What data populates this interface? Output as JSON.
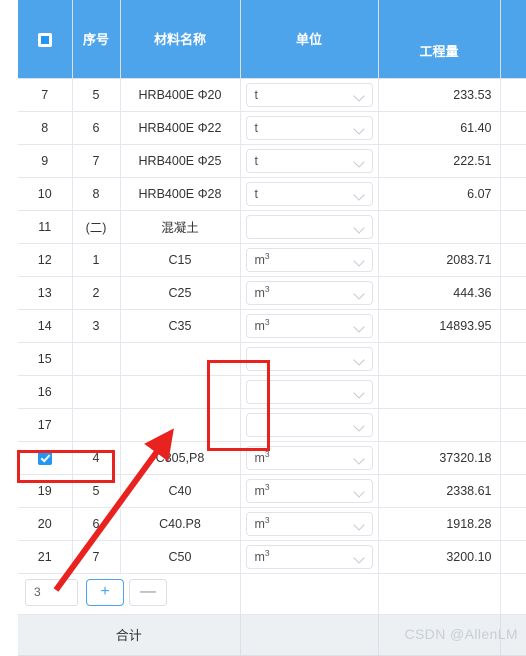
{
  "table": {
    "columns": [
      {
        "key": "check",
        "label": "",
        "icon": "indeterminate-checkbox-icon"
      },
      {
        "key": "seq",
        "label": "序号"
      },
      {
        "key": "name",
        "label": "材料名称"
      },
      {
        "key": "unit",
        "label": "单位"
      },
      {
        "key": "qty",
        "label": "工程量"
      },
      {
        "key": "tail",
        "label": ""
      }
    ],
    "rows": [
      {
        "idx": "7",
        "seq": "5",
        "name": "HRB400E Φ20",
        "unit": "t",
        "unit_sup": "",
        "qty": "233.53",
        "checked": false
      },
      {
        "idx": "8",
        "seq": "6",
        "name": "HRB400E Φ22",
        "unit": "t",
        "unit_sup": "",
        "qty": "61.40",
        "checked": false
      },
      {
        "idx": "9",
        "seq": "7",
        "name": "HRB400E Φ25",
        "unit": "t",
        "unit_sup": "",
        "qty": "222.51",
        "checked": false
      },
      {
        "idx": "10",
        "seq": "8",
        "name": "HRB400E Φ28",
        "unit": "t",
        "unit_sup": "",
        "qty": "6.07",
        "checked": false
      },
      {
        "idx": "11",
        "seq": "(二)",
        "name": "混凝土",
        "unit": "",
        "unit_sup": "",
        "qty": "",
        "checked": false
      },
      {
        "idx": "12",
        "seq": "1",
        "name": "C15",
        "unit": "m",
        "unit_sup": "3",
        "qty": "2083.71",
        "checked": false
      },
      {
        "idx": "13",
        "seq": "2",
        "name": "C25",
        "unit": "m",
        "unit_sup": "3",
        "qty": "444.36",
        "checked": false
      },
      {
        "idx": "14",
        "seq": "3",
        "name": "C35",
        "unit": "m",
        "unit_sup": "3",
        "qty": "14893.95",
        "checked": false
      },
      {
        "idx": "15",
        "seq": "",
        "name": "",
        "unit": "",
        "unit_sup": "",
        "qty": "",
        "checked": false
      },
      {
        "idx": "16",
        "seq": "",
        "name": "",
        "unit": "",
        "unit_sup": "",
        "qty": "",
        "checked": false
      },
      {
        "idx": "17",
        "seq": "",
        "name": "",
        "unit": "",
        "unit_sup": "",
        "qty": "",
        "checked": false
      },
      {
        "idx": "",
        "seq": "4",
        "name": "C305,P8",
        "unit": "m",
        "unit_sup": "3",
        "qty": "37320.18",
        "checked": true
      },
      {
        "idx": "19",
        "seq": "5",
        "name": "C40",
        "unit": "m",
        "unit_sup": "3",
        "qty": "2338.61",
        "checked": false
      },
      {
        "idx": "20",
        "seq": "6",
        "name": "C40.P8",
        "unit": "m",
        "unit_sup": "3",
        "qty": "1918.28",
        "checked": false
      },
      {
        "idx": "21",
        "seq": "7",
        "name": "C50",
        "unit": "m",
        "unit_sup": "3",
        "qty": "3200.10",
        "checked": false
      }
    ]
  },
  "adder": {
    "count_value": "3",
    "add_label": "+",
    "remove_label": "—"
  },
  "footer": {
    "total_label": "合计"
  },
  "watermark": {
    "text": "CSDN @AllenLM"
  },
  "annotations": {
    "accent_color": "#e8231f",
    "rect_empty_cells": "highlight-empty-name-cells",
    "rect_selected_row": "highlight-checked-row",
    "arrow": "arrow-pointing-to-checked-row"
  },
  "colors": {
    "header_blue": "#4da4ea",
    "checkbox_blue": "#2196f3",
    "button_blue": "#4aa3f0",
    "footer_gray": "#ecf0f3",
    "border_gray": "#e4e7ed"
  }
}
